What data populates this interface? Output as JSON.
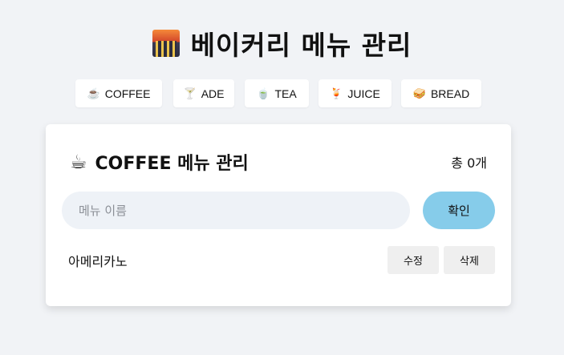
{
  "header": {
    "title": "베이커리 메뉴 관리",
    "logo_icon": "city-dusk-icon"
  },
  "tabs": [
    {
      "icon": "☕",
      "icon_name": "coffee-icon",
      "label": "COFFEE"
    },
    {
      "icon": "🍸",
      "icon_name": "cocktail-glass-icon",
      "label": "ADE"
    },
    {
      "icon": "🍵",
      "icon_name": "tea-cup-icon",
      "label": "TEA"
    },
    {
      "icon": "🍹",
      "icon_name": "tropical-drink-icon",
      "label": "JUICE"
    },
    {
      "icon": "🥪",
      "icon_name": "sandwich-icon",
      "label": "BREAD"
    }
  ],
  "card": {
    "icon": "☕",
    "title": "COFFEE 메뉴 관리",
    "count": "총 0개",
    "input_placeholder": "메뉴 이름",
    "input_value": "",
    "confirm_label": "확인",
    "items": [
      {
        "name": "아메리카노",
        "edit_label": "수정",
        "delete_label": "삭제"
      }
    ]
  },
  "colors": {
    "background": "#f1f3f6",
    "confirm_button": "#86ccea",
    "input_bg": "#eef2f7"
  }
}
